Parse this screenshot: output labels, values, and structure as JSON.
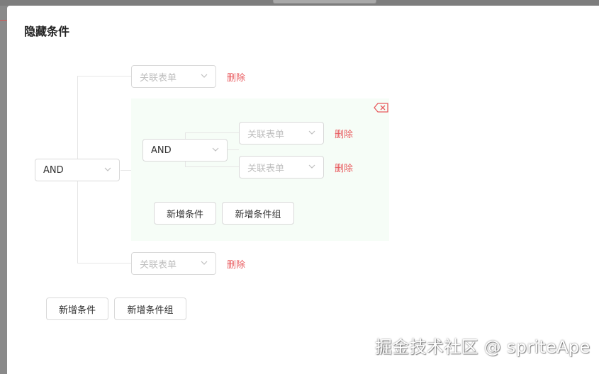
{
  "modal": {
    "title": "隐藏条件"
  },
  "root": {
    "operator": "AND",
    "conditions": [
      {
        "placeholder": "关联表单",
        "delete_label": "删除"
      },
      {
        "placeholder": "关联表单",
        "delete_label": "删除"
      }
    ],
    "add_condition_label": "新增条件",
    "add_group_label": "新增条件组"
  },
  "group": {
    "operator": "AND",
    "conditions": [
      {
        "placeholder": "关联表单",
        "delete_label": "删除"
      },
      {
        "placeholder": "关联表单",
        "delete_label": "删除"
      }
    ],
    "add_condition_label": "新增条件",
    "add_group_label": "新增条件组",
    "remove_icon": "backspace-x-icon"
  },
  "watermark": "掘金技术社区 @ spriteApe",
  "colors": {
    "delete": "#e8595d",
    "group_bg": "#f6fdf7",
    "border": "#d9d9d9",
    "placeholder": "#bfbfbf"
  }
}
